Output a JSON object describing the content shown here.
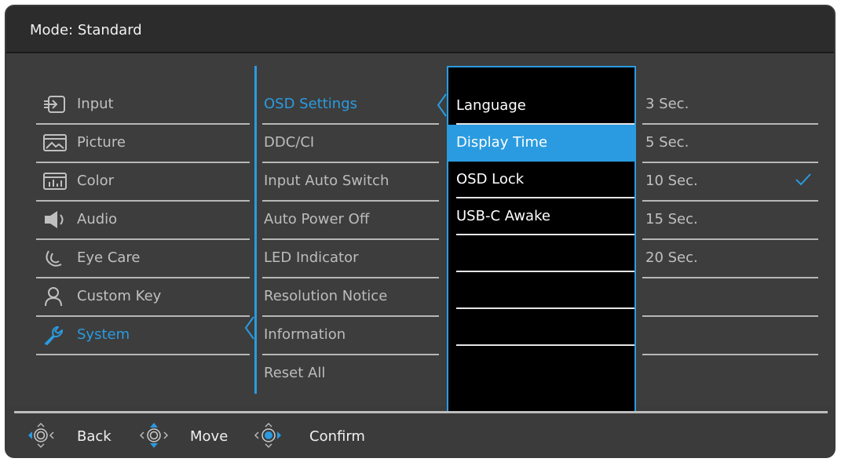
{
  "header": {
    "mode_label": "Mode: Standard"
  },
  "main_menu": {
    "items": [
      {
        "label": "Input",
        "icon": "input-icon"
      },
      {
        "label": "Picture",
        "icon": "picture-icon"
      },
      {
        "label": "Color",
        "icon": "color-icon"
      },
      {
        "label": "Audio",
        "icon": "audio-icon"
      },
      {
        "label": "Eye Care",
        "icon": "eye-care-icon"
      },
      {
        "label": "Custom Key",
        "icon": "custom-key-icon"
      },
      {
        "label": "System",
        "icon": "system-icon",
        "active": true
      }
    ]
  },
  "system_menu": {
    "items": [
      {
        "label": "OSD Settings",
        "active": true
      },
      {
        "label": "DDC/CI"
      },
      {
        "label": "Input Auto Switch"
      },
      {
        "label": "Auto Power Off"
      },
      {
        "label": "LED Indicator"
      },
      {
        "label": "Resolution Notice"
      },
      {
        "label": "Information"
      },
      {
        "label": "Reset All"
      }
    ]
  },
  "osd_settings_menu": {
    "items": [
      {
        "label": "Language"
      },
      {
        "label": "Display Time",
        "highlighted": true
      },
      {
        "label": "OSD Lock"
      },
      {
        "label": "USB-C Awake"
      },
      {
        "label": ""
      },
      {
        "label": ""
      },
      {
        "label": ""
      },
      {
        "label": ""
      }
    ]
  },
  "display_time_options": {
    "items": [
      {
        "label": "3 Sec."
      },
      {
        "label": "5 Sec."
      },
      {
        "label": "10 Sec.",
        "selected": true
      },
      {
        "label": "15 Sec."
      },
      {
        "label": "20 Sec."
      },
      {
        "label": ""
      },
      {
        "label": ""
      }
    ]
  },
  "footer": {
    "back_label": "Back",
    "move_label": "Move",
    "confirm_label": "Confirm"
  },
  "colors": {
    "accent": "#2a9be0",
    "background": "#3d3d3d",
    "panel": "#000000"
  }
}
